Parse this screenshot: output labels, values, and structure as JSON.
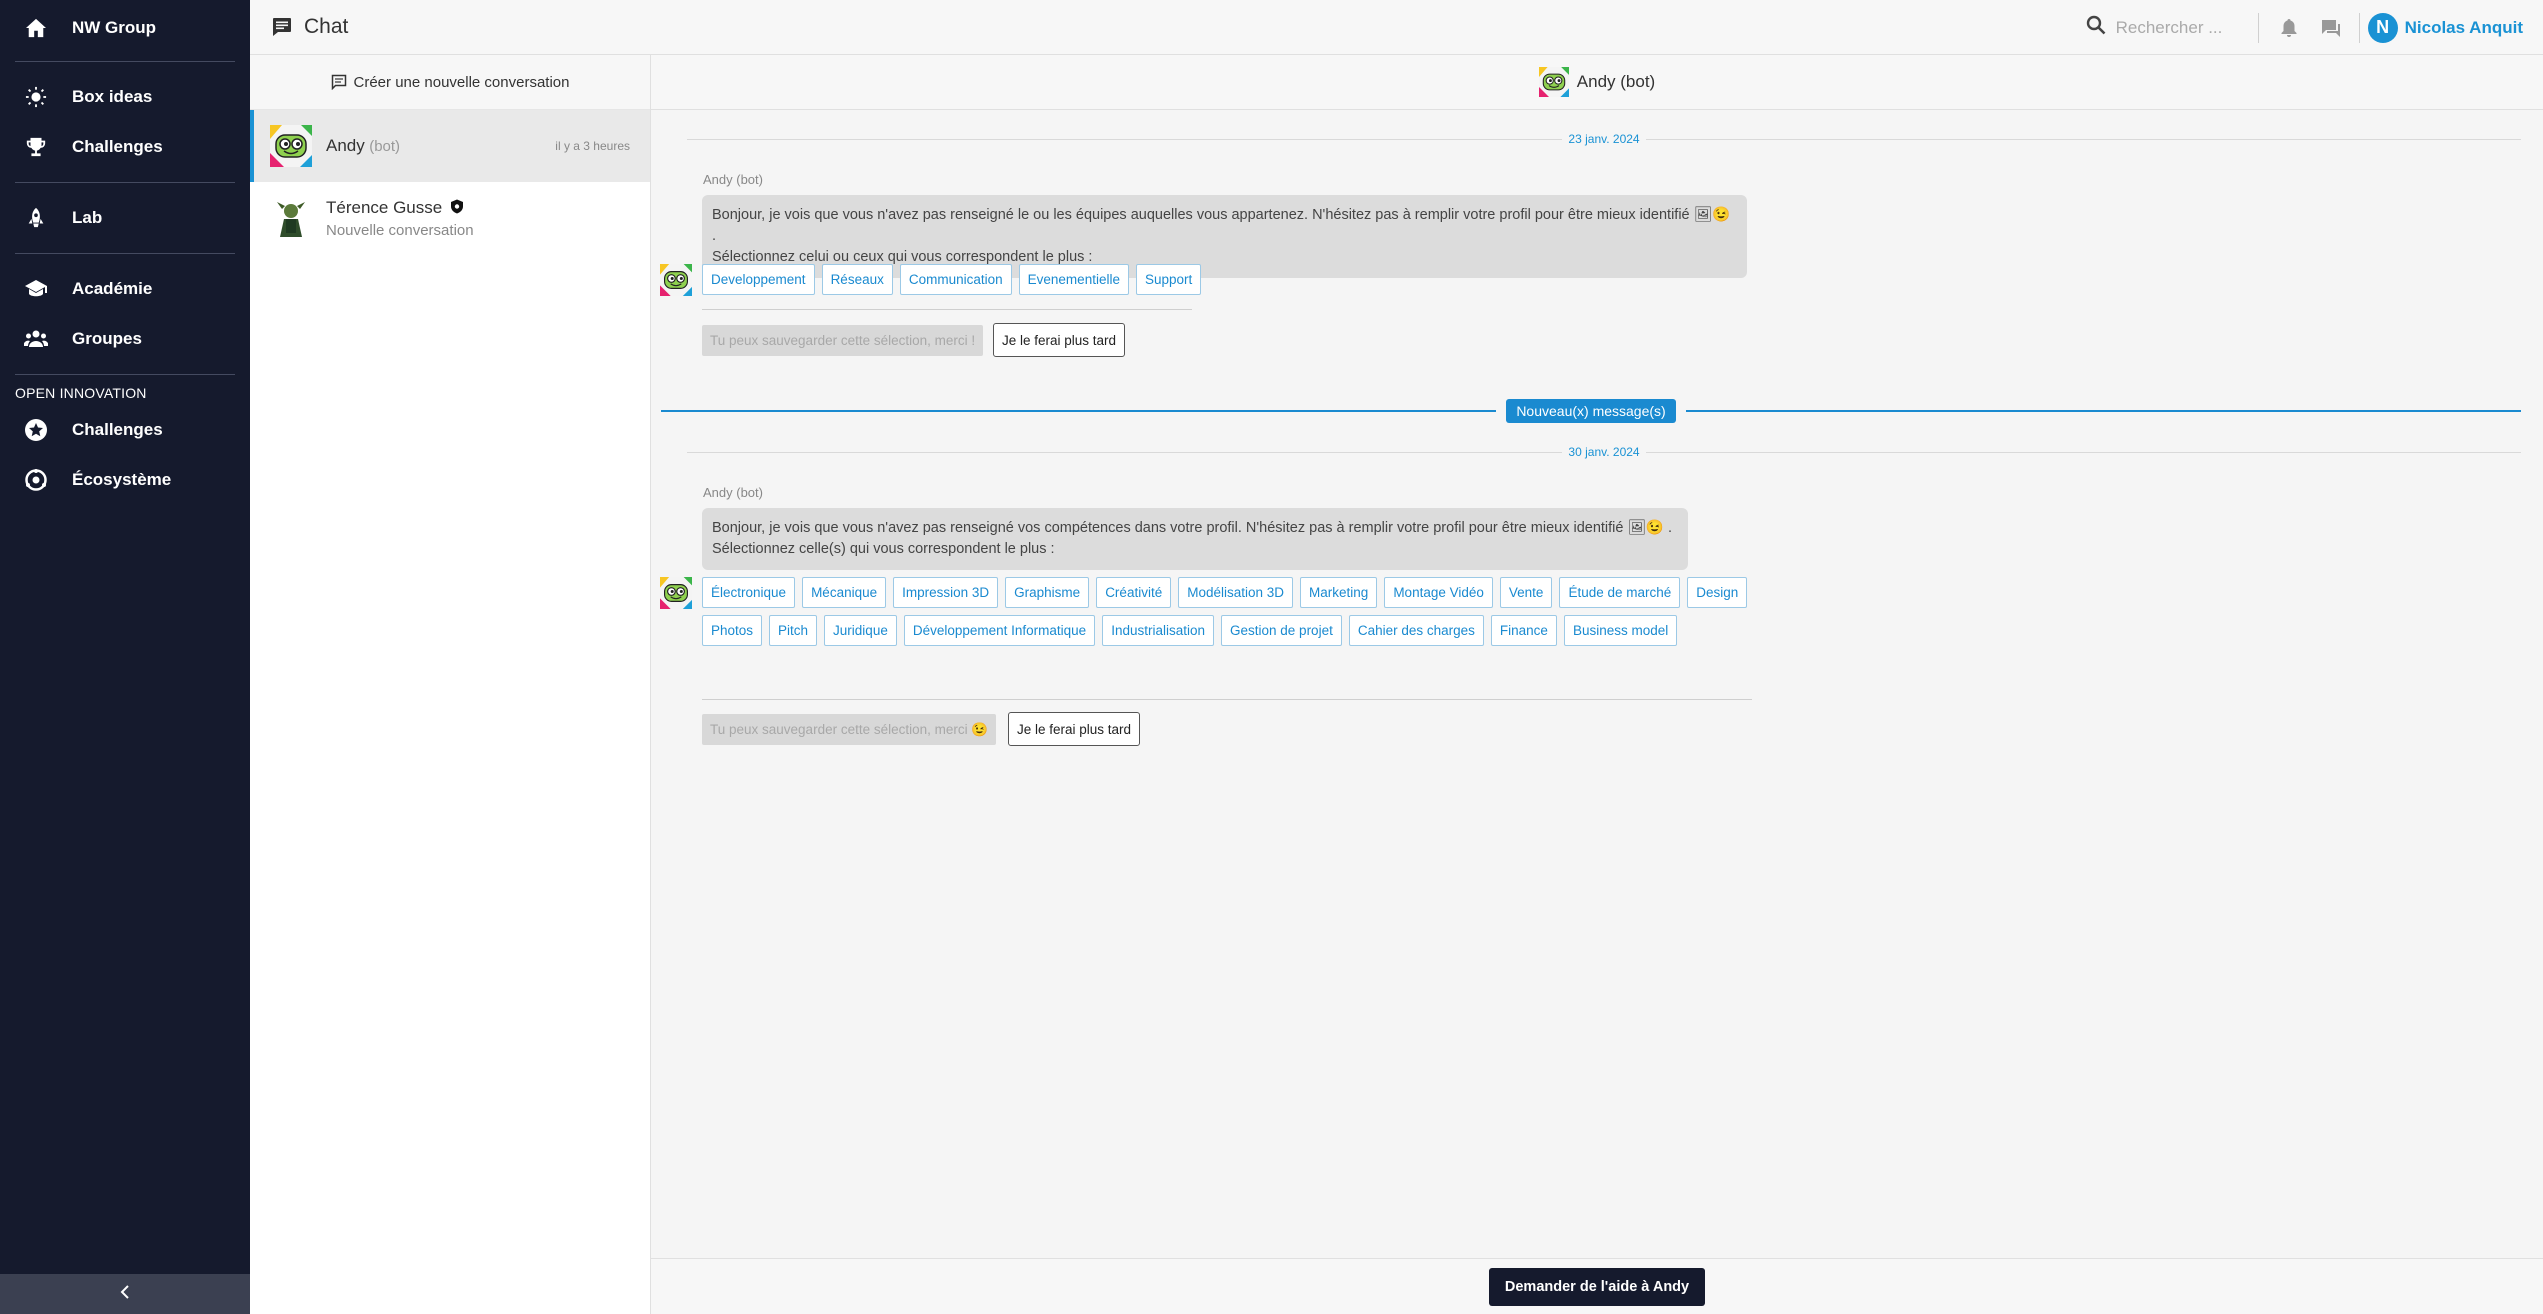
{
  "sidebar": {
    "brand": "NW Group",
    "items": [
      {
        "label": "Box ideas",
        "icon": "lightbulb-icon"
      },
      {
        "label": "Challenges",
        "icon": "trophy-icon"
      },
      {
        "label": "Lab",
        "icon": "rocket-icon"
      },
      {
        "label": "Académie",
        "icon": "graduation-cap-icon"
      },
      {
        "label": "Groupes",
        "icon": "group-icon"
      }
    ],
    "section_label": "OPEN INNOVATION",
    "section_items": [
      {
        "label": "Challenges",
        "icon": "star-badge-icon"
      },
      {
        "label": "Écosystème",
        "icon": "ecosystem-icon"
      }
    ],
    "collapse_icon": "chevron-left-icon"
  },
  "header": {
    "title": "Chat",
    "search_placeholder": "Rechercher ...",
    "user_initial": "N",
    "user_name": "Nicolas Anquit"
  },
  "conversations": {
    "new_label": "Créer une nouvelle conversation",
    "items": [
      {
        "name": "Andy",
        "tag": "(bot)",
        "time": "il y a 3 heures",
        "active": true
      },
      {
        "name": "Térence Gusse",
        "subtitle": "Nouvelle conversation",
        "active": false
      }
    ]
  },
  "chat": {
    "header_name": "Andy (bot)",
    "new_messages_label": "Nouveau(x) message(s)",
    "help_button": "Demander de l'aide à Andy",
    "messages": [
      {
        "date": "23 janv. 2024",
        "author": "Andy (bot)",
        "line1": "Bonjour, je vois que vous n'avez pas renseigné le ou les équipes auquelles vous appartenez. N'hésitez pas à remplir votre profil pour être mieux identifié",
        "line2": "Sélectionnez celui ou ceux qui vous correspondent le plus :",
        "options": [
          "Developpement",
          "Réseaux",
          "Communication",
          "Evenementielle",
          "Support"
        ],
        "save_label": "Tu peux sauvegarder cette sélection, merci !",
        "later_label": "Je le ferai plus tard"
      },
      {
        "date": "30 janv. 2024",
        "author": "Andy (bot)",
        "line1": "Bonjour, je vois que vous n'avez pas renseigné vos compétences dans votre profil. N'hésitez pas à remplir votre profil pour être mieux identifié",
        "line2": "Sélectionnez celle(s) qui vous correspondent le plus :",
        "options": [
          "Électronique",
          "Mécanique",
          "Impression 3D",
          "Graphisme",
          "Créativité",
          "Modélisation 3D",
          "Marketing",
          "Montage Vidéo",
          "Vente",
          "Étude de marché",
          "Design",
          "Photos",
          "Pitch",
          "Juridique",
          "Développement Informatique",
          "Industrialisation",
          "Gestion de projet",
          "Cahier des charges",
          "Finance",
          "Business model"
        ],
        "save_label": "Tu peux sauvegarder cette sélection, merci 😉",
        "later_label": "Je le ferai plus tard"
      }
    ]
  },
  "colors": {
    "sidebar_bg": "#151a2d",
    "accent": "#1a92d4",
    "help_button_bg": "#151a2d"
  }
}
